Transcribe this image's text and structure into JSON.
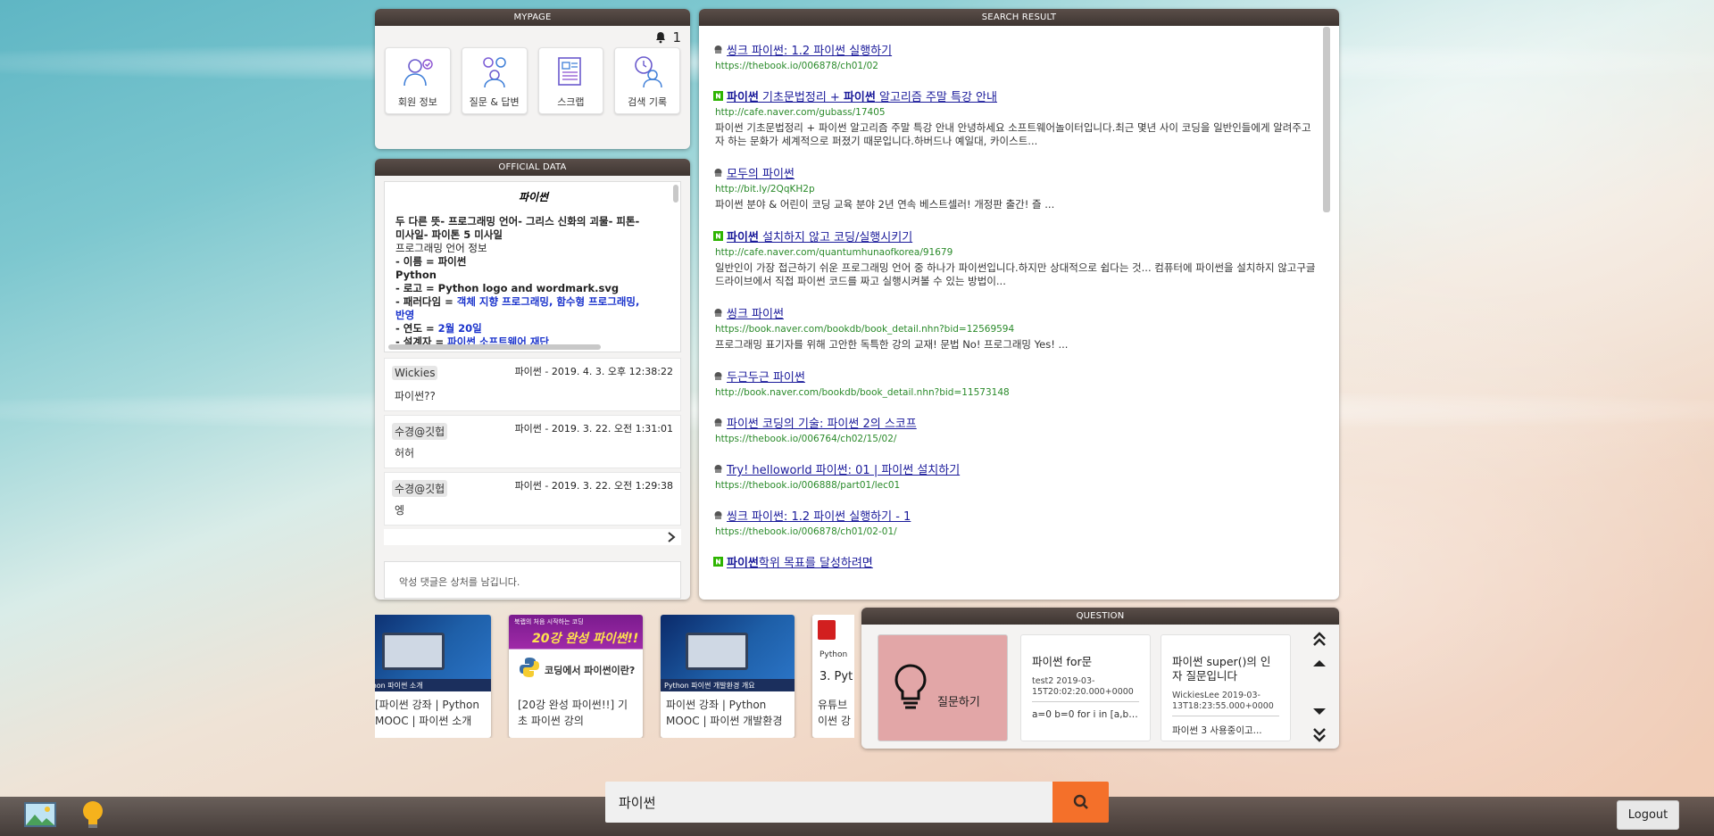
{
  "mypage": {
    "header": "MYPAGE",
    "notification_count": "1",
    "buttons": [
      {
        "label": "회원 정보",
        "icon": "member-info-icon"
      },
      {
        "label": "질문 & 답변",
        "icon": "qna-icon"
      },
      {
        "label": "스크랩",
        "icon": "scrap-icon"
      },
      {
        "label": "검색 기록",
        "icon": "search-history-icon"
      }
    ]
  },
  "official": {
    "header": "OFFICIAL DATA",
    "wiki_title": "파이썬",
    "wiki_lines": [
      "두 다른 뜻- 프로그래밍 언어- 그리스 신화의 괴물- 피톤-",
      "미사일- 파이톤 5 미사일",
      "프로그래밍 언어 정보",
      "- 이름 = 파이썬",
      "Python",
      "- 로고 = Python logo and wordmark.svg",
      "- 패러다임 = ",
      "객체 지향 프로그래밍, 함수형 프로그래밍,",
      "반영",
      "- 연도 = ",
      "2월 20일",
      "- 설계자 = ",
      "파이썬 소프트웨어 재단"
    ],
    "comments": [
      {
        "author": "Wickies",
        "meta": "파이썬 - 2019. 4. 3. 오후 12:38:22",
        "text": "파이썬??"
      },
      {
        "author": "수경@깃헙",
        "meta": "파이썬 - 2019. 3. 22. 오전 1:31:01",
        "text": "허허"
      },
      {
        "author": "수경@깃헙",
        "meta": "파이썬 - 2019. 3. 22. 오전 1:29:38",
        "text": "엥"
      }
    ],
    "comment_placeholder": "악성 댓글은 상처를 남깁니다."
  },
  "search": {
    "header": "SEARCH RESULT",
    "results": [
      {
        "source": "book",
        "title_parts": [
          "씽크 파이썬: 1.2 파이썬 실행하기"
        ],
        "url": "https://thebook.io/006878/ch01/02",
        "desc": ""
      },
      {
        "source": "naver",
        "title_parts": [
          "파이썬",
          " 기초문법정리 + ",
          "파이썬",
          " 알고리즘 주말 특강 안내"
        ],
        "url": "http://cafe.naver.com/gubass/17405",
        "desc": "파이썬 기초문법정리 + 파이썬 알고리즘 주말 특강 안내 안녕하세요 소프트웨어놀이터입니다.최근 몇년 사이 코딩을 일반인들에게 알려주고자 하는 문화가 세계적으로 퍼졌기 때문입니다.하버드나 예일대, 카이스트..."
      },
      {
        "source": "book",
        "title_parts": [
          "모두의 파이썬"
        ],
        "url": "http://bit.ly/2QqKH2p",
        "desc": "파이썬 분야 & 어린이 코딩 교육 분야 2년 연속 베스트셀러! 개정판 출간! 즐 ..."
      },
      {
        "source": "naver",
        "title_parts": [
          "파이썬",
          " 설치하지 않고 코딩/실행시키기"
        ],
        "url": "http://cafe.naver.com/quantumhunaofkorea/91679",
        "desc": "일반인이 가장 접근하기 쉬운 프로그래밍 언어 중 하나가 파이썬입니다.하지만 상대적으로 쉽다는 것... 컴퓨터에 파이썬을 설치하지 않고구글 드라이브에서 직접 파이썬 코드를 짜고 실행시켜볼 수 있는 방법이..."
      },
      {
        "source": "book",
        "title_parts": [
          "씽크 파이썬"
        ],
        "url": "https://book.naver.com/bookdb/book_detail.nhn?bid=12569594",
        "desc": "프로그래밍 표기자를 위해 고안한 독특한 강의 교재! 문법 No! 프로그래밍 Yes! ..."
      },
      {
        "source": "book",
        "title_parts": [
          "두근두근 파이썬"
        ],
        "url": "http://book.naver.com/bookdb/book_detail.nhn?bid=11573148",
        "desc": ""
      },
      {
        "source": "book",
        "title_parts": [
          "파이썬 코딩의 기술: 파이썬 2의 스코프"
        ],
        "url": "https://thebook.io/006764/ch02/15/02/",
        "desc": ""
      },
      {
        "source": "book",
        "title_parts": [
          "Try! helloworld 파이썬: 01 | 파이썬 설치하기"
        ],
        "url": "https://thebook.io/006888/part01/lec01",
        "desc": ""
      },
      {
        "source": "book",
        "title_parts": [
          "씽크 파이썬: 1.2 파이썬 실행하기 - 1"
        ],
        "url": "https://thebook.io/006878/ch01/02-01/",
        "desc": ""
      },
      {
        "source": "naver",
        "title_parts": [
          "파이썬",
          "학위 목표를 달성하려면"
        ],
        "url": "",
        "desc": ""
      }
    ]
  },
  "videos": [
    {
      "title": "[파이썬 강좌 | Python MOOC | 파이썬 소개",
      "thumb_text": "Python    파이썬 소개"
    },
    {
      "title": "[20강 완성 파이썬!!] 기초 파이썬 강의",
      "thumb_top": "북랩의 처음 시작하는 코딩",
      "thumb_big": "20강 완성 파이썬!!",
      "thumb_sub": "코딩에서 파이썬이란?"
    },
    {
      "title": "파이썬 강좌 | Python MOOC | 파이썬 개발환경",
      "thumb_text": "Python    파이썬 개발환경 개요"
    },
    {
      "title": "유튜브 이썬 강",
      "thumb_text": "Python",
      "thumb_sub": "3. Pyt"
    }
  ],
  "question": {
    "header": "QUESTION",
    "ask_label": "질문하기",
    "cards": [
      {
        "title": "파이썬 for문",
        "meta": "test2 2019-03-15T20:02:20.000+0000",
        "body": "a=0 b=0 for i in [a,b]:..."
      },
      {
        "title": "파이썬 super()의 인자 질문입니다",
        "meta": "WickiesLee 2019-03-13T18:23:55.000+0000",
        "body": "파이썬 3 사용중이고..."
      }
    ]
  },
  "bottom": {
    "search_value": "파이썬",
    "logout_label": "Logout"
  },
  "colors": {
    "header_bg": "#4a3f3b",
    "accent": "#f4702a",
    "ask_bg": "#e2a6a7"
  }
}
